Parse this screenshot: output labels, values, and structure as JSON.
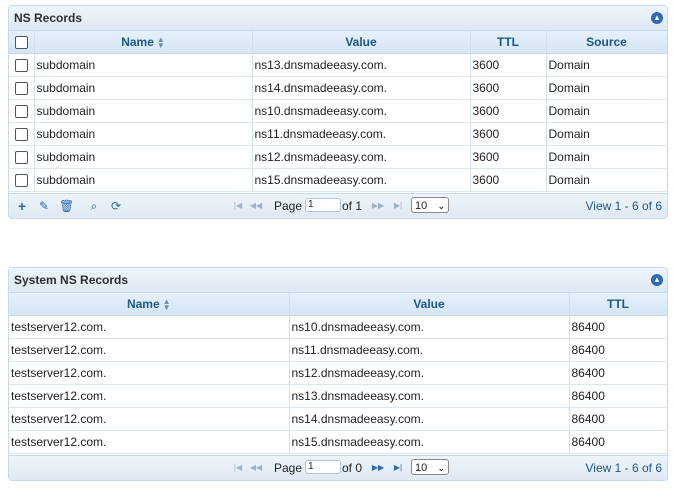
{
  "ns_records": {
    "title": "NS Records",
    "columns": {
      "name": "Name",
      "value": "Value",
      "ttl": "TTL",
      "source": "Source"
    },
    "rows": [
      {
        "name": "subdomain",
        "value": "ns13.dnsmadeeasy.com.",
        "ttl": "3600",
        "source": "Domain"
      },
      {
        "name": "subdomain",
        "value": "ns14.dnsmadeeasy.com.",
        "ttl": "3600",
        "source": "Domain"
      },
      {
        "name": "subdomain",
        "value": "ns10.dnsmadeeasy.com.",
        "ttl": "3600",
        "source": "Domain"
      },
      {
        "name": "subdomain",
        "value": "ns11.dnsmadeeasy.com.",
        "ttl": "3600",
        "source": "Domain"
      },
      {
        "name": "subdomain",
        "value": "ns12.dnsmadeeasy.com.",
        "ttl": "3600",
        "source": "Domain"
      },
      {
        "name": "subdomain",
        "value": "ns15.dnsmadeeasy.com.",
        "ttl": "3600",
        "source": "Domain"
      }
    ],
    "pager": {
      "page_label": "Page",
      "page_value": "1",
      "of_label": "of 1",
      "rows_per_page": "10",
      "view_text": "View 1 - 6 of 6"
    }
  },
  "system_ns_records": {
    "title": "System NS Records",
    "columns": {
      "name": "Name",
      "value": "Value",
      "ttl": "TTL"
    },
    "rows": [
      {
        "name": "testserver12.com.",
        "value": "ns10.dnsmadeeasy.com.",
        "ttl": "86400"
      },
      {
        "name": "testserver12.com.",
        "value": "ns11.dnsmadeeasy.com.",
        "ttl": "86400"
      },
      {
        "name": "testserver12.com.",
        "value": "ns12.dnsmadeeasy.com.",
        "ttl": "86400"
      },
      {
        "name": "testserver12.com.",
        "value": "ns13.dnsmadeeasy.com.",
        "ttl": "86400"
      },
      {
        "name": "testserver12.com.",
        "value": "ns14.dnsmadeeasy.com.",
        "ttl": "86400"
      },
      {
        "name": "testserver12.com.",
        "value": "ns15.dnsmadeeasy.com.",
        "ttl": "86400"
      }
    ],
    "pager": {
      "page_label": "Page",
      "page_value": "1",
      "of_label": "of 0",
      "rows_per_page": "10",
      "view_text": "View 1 - 6 of 6"
    }
  },
  "icons": {
    "collapse": "collapse-up-icon",
    "add": "plus-icon",
    "edit": "pencil-icon",
    "delete": "trash-icon",
    "search": "magnifier-icon",
    "refresh": "refresh-icon",
    "first": "first-page-icon",
    "prev": "prev-page-icon",
    "next": "next-page-icon",
    "last": "last-page-icon"
  },
  "colors": {
    "header_text": "#1d5987",
    "accent": "#2e6ab1",
    "border": "#c5dbec"
  }
}
